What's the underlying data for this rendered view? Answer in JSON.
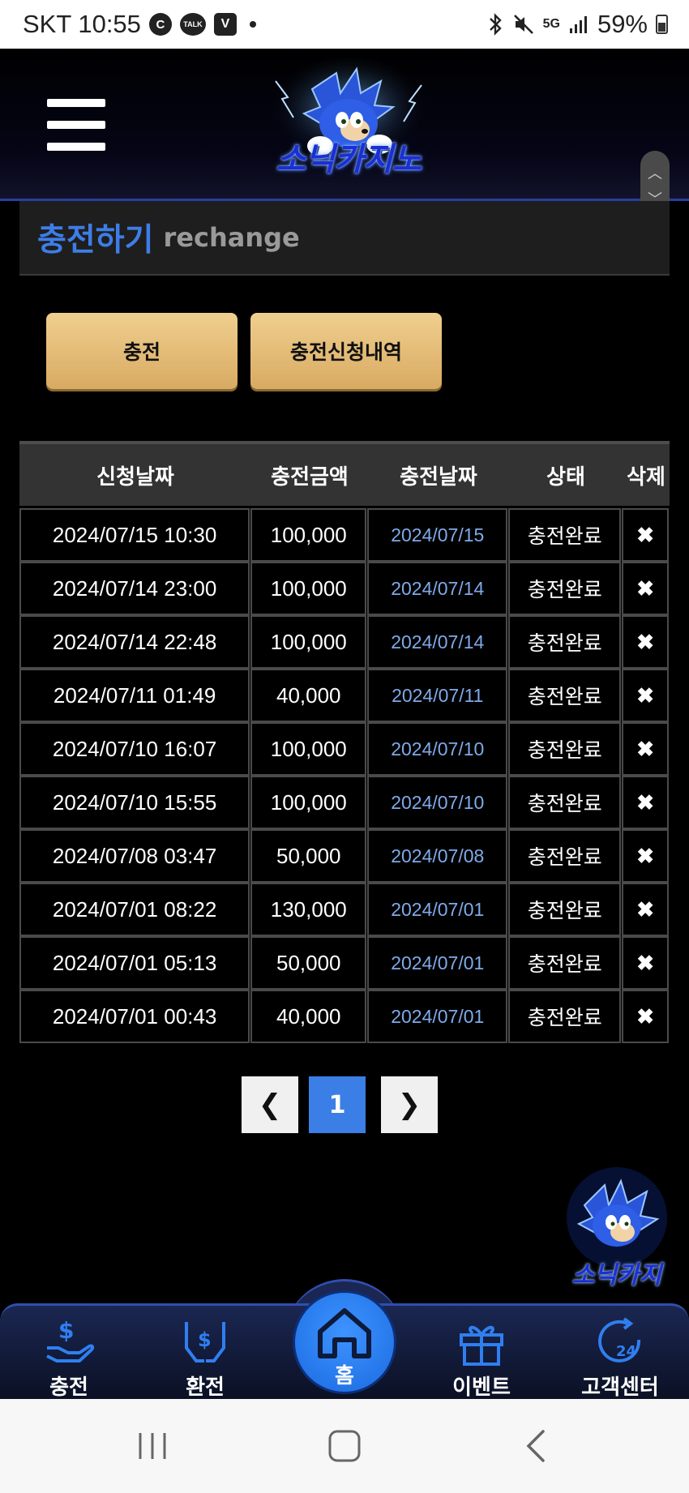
{
  "statusbar": {
    "carrier_time": "SKT 10:55",
    "icon_c": "C",
    "icon_talk": "TALK",
    "icon_v": "V",
    "signal": "5G",
    "battery": "59%"
  },
  "header": {
    "logo_text": "소닉카지노"
  },
  "page": {
    "title_ko": "충전하기",
    "title_en": "rechange"
  },
  "buttons": {
    "charge": "충전",
    "history": "충전신청내역"
  },
  "table": {
    "headers": [
      "신청날짜",
      "충전금액",
      "충전날짜",
      "상태",
      "삭제"
    ],
    "rows": [
      {
        "request_date": "2024/07/15 10:30",
        "amount": "100,000",
        "charge_date": "2024/07/15",
        "status": "충전완료",
        "delete": "✖"
      },
      {
        "request_date": "2024/07/14 23:00",
        "amount": "100,000",
        "charge_date": "2024/07/14",
        "status": "충전완료",
        "delete": "✖"
      },
      {
        "request_date": "2024/07/14 22:48",
        "amount": "100,000",
        "charge_date": "2024/07/14",
        "status": "충전완료",
        "delete": "✖"
      },
      {
        "request_date": "2024/07/11 01:49",
        "amount": "40,000",
        "charge_date": "2024/07/11",
        "status": "충전완료",
        "delete": "✖"
      },
      {
        "request_date": "2024/07/10 16:07",
        "amount": "100,000",
        "charge_date": "2024/07/10",
        "status": "충전완료",
        "delete": "✖"
      },
      {
        "request_date": "2024/07/10 15:55",
        "amount": "100,000",
        "charge_date": "2024/07/10",
        "status": "충전완료",
        "delete": "✖"
      },
      {
        "request_date": "2024/07/08 03:47",
        "amount": "50,000",
        "charge_date": "2024/07/08",
        "status": "충전완료",
        "delete": "✖"
      },
      {
        "request_date": "2024/07/01 08:22",
        "amount": "130,000",
        "charge_date": "2024/07/01",
        "status": "충전완료",
        "delete": "✖"
      },
      {
        "request_date": "2024/07/01 05:13",
        "amount": "50,000",
        "charge_date": "2024/07/01",
        "status": "충전완료",
        "delete": "✖"
      },
      {
        "request_date": "2024/07/01 00:43",
        "amount": "40,000",
        "charge_date": "2024/07/01",
        "status": "충전완료",
        "delete": "✖"
      }
    ]
  },
  "pagination": {
    "prev": "❮",
    "current": "1",
    "next": "❯"
  },
  "float_logo_text": "소닉카지",
  "bottom_nav": {
    "charge": "충전",
    "exchange": "환전",
    "home": "홈",
    "event": "이벤트",
    "support": "고객센터",
    "support_badge": "24"
  },
  "colors": {
    "accent_blue": "#3d7de8",
    "gold": "#e6c07a",
    "charge_date_text": "#7faae8"
  },
  "icons": [
    "hamburger-icon",
    "sonic-logo",
    "hand-dollar-icon",
    "exchange-icon",
    "home-icon",
    "gift-icon",
    "support-24-icon",
    "recents-icon",
    "home-circle-icon",
    "back-icon"
  ]
}
